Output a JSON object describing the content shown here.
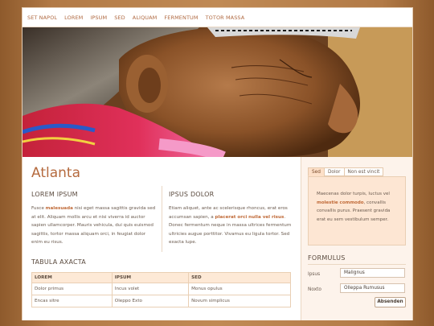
{
  "nav": {
    "items": [
      "SET NAPOL",
      "LOREM",
      "IPSUM",
      "SED",
      "ALIQUAM",
      "FERMENTUM",
      "TOTOR MASSA"
    ]
  },
  "hero": {
    "image": "elderly-woman-profile-photo"
  },
  "main": {
    "title": "Atlanta",
    "col1": {
      "heading": "LOREM IPSUM",
      "text_before": "Fusce ",
      "bold": "malesuada",
      "text_after": " nisi eget massa sagittis gravida sed at elit.  Aliquam mollis arcu et nisi viverra id auctor sapien ullamcorper.  Mauris vehicula, dui quis euismod sagittis, tortor massa aliquam orci, in feugiat dolor enim eu risus."
    },
    "col2": {
      "heading": "IPSUS DOLOR",
      "text_before": "Etiam aliquet, ante ac scelerisque rhoncus, erat eros accumsan sapien, a ",
      "bold": "placerat orci nulla vel risus",
      "text_after": ". Donec fermentum neque in massa ultrices fermentum ultricies augue porttitor.  Vivamus eu ligula tortor.  Sed exacta lupe."
    },
    "table": {
      "title": "TABULA AXACTA",
      "headers": [
        "LOREM",
        "IPSUM",
        "SED"
      ],
      "rows": [
        [
          "Dolor primus",
          "Incus volet",
          "Monus opulus"
        ],
        [
          "Encas sitre",
          "Oleppo Exto",
          "Novum simplicus"
        ]
      ]
    }
  },
  "sidebar": {
    "tabs": [
      "Sed",
      "Dolor",
      "Non est vincit"
    ],
    "active_tab": "Sed",
    "panel": {
      "text_before": "Maecenas dolor turpis, luctus vel ",
      "bold": "molestie commodo",
      "text_after": ", convallis convallis purus. Praesent gravida erat eu sem vestibulum semper."
    },
    "form": {
      "heading": "FORMULUS",
      "field1": {
        "label": "Ipsus",
        "value": "Malignus"
      },
      "field2": {
        "label": "Noxto",
        "value": "Olleppa Rumusus"
      },
      "submit_label": "Absenden"
    }
  },
  "colors": {
    "accent": "#b56a3e",
    "background": "#b27a46",
    "panel": "#fde6d3"
  }
}
